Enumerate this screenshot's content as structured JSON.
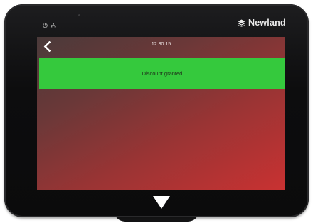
{
  "device": {
    "brand_name": "Newland",
    "status_icons": [
      "power-icon",
      "network-icon"
    ]
  },
  "screen": {
    "time": "12:30:15",
    "back_icon": "chevron-left-icon",
    "banner": {
      "message": "Discount granted",
      "color": "#35c93d"
    },
    "background_colors": [
      "#4a3a3a",
      "#c93232"
    ]
  },
  "bezel_nav": {
    "down_icon": "triangle-down-icon"
  }
}
